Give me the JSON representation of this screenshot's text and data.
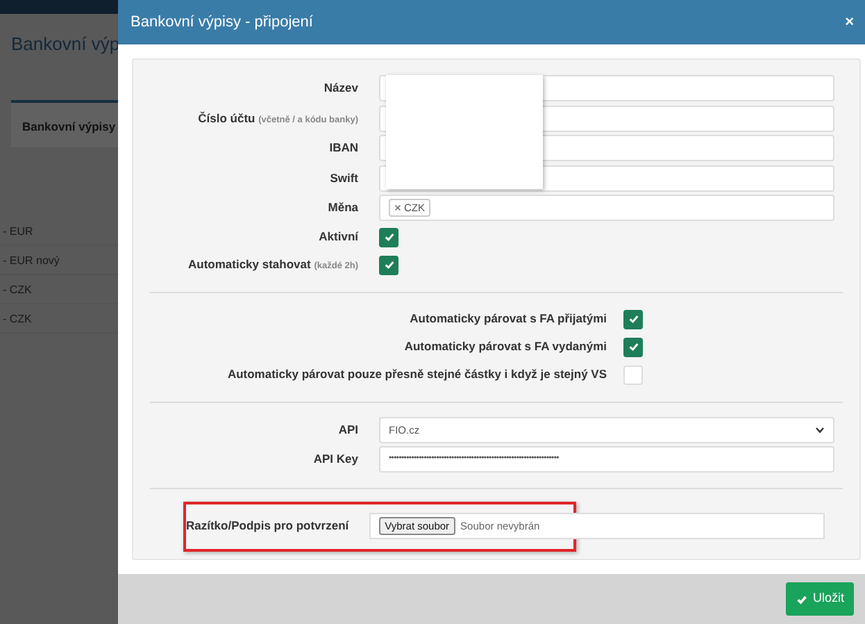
{
  "background_page": {
    "heading": "Bankovní výp",
    "tab": "Bankovní výpisy",
    "accounts": [
      "- EUR",
      "- EUR nový",
      "- CZK",
      "- CZK"
    ]
  },
  "modal": {
    "title": "Bankovní výpisy - připojení",
    "close": "×",
    "fields": [
      {
        "kind": "text",
        "label": "Název"
      },
      {
        "kind": "text",
        "label": "Číslo účtu",
        "hint": "(včetně / a kódu banky)"
      },
      {
        "kind": "text",
        "label": "IBAN"
      },
      {
        "kind": "text",
        "label": "Swift"
      },
      {
        "kind": "tags",
        "label": "Měna",
        "tags": [
          "CZK"
        ]
      },
      {
        "kind": "checkbox",
        "label": "Aktivní",
        "checked": true
      },
      {
        "kind": "checkbox",
        "label": "Automaticky stahovat",
        "hint": "(každé 2h)",
        "checked": true
      }
    ],
    "pairing": [
      {
        "label": "Automaticky párovat s FA přijatými",
        "checked": true
      },
      {
        "label": "Automaticky párovat s FA vydanými",
        "checked": true
      },
      {
        "label": "Automaticky párovat pouze přesně stejné částky i když je stejný VS",
        "checked": false
      }
    ],
    "api": [
      {
        "kind": "select",
        "label": "API",
        "value": "FIO.cz"
      },
      {
        "kind": "password",
        "label": "API Key",
        "value": "••••••••••••••••••••••••••••••••••••••••••••••••••••••••••••••••••••"
      }
    ],
    "stamp": {
      "label": "Razítko/Podpis pro potvrzení",
      "button": "Vybrat soubor",
      "status": "Soubor nevybrán",
      "highlighted": true
    },
    "save_button": "Uložit"
  }
}
